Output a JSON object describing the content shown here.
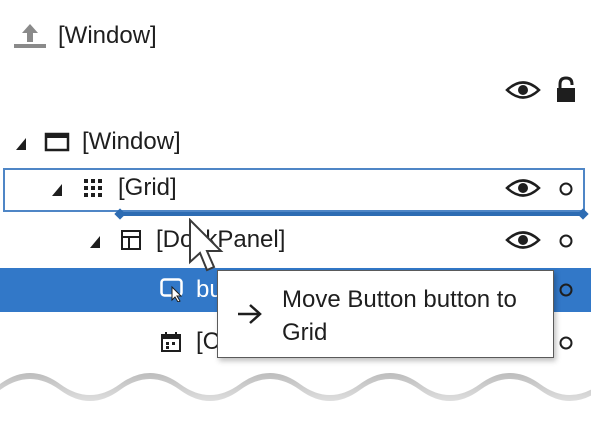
{
  "move_up": {
    "icon": "move-up-icon",
    "label": "[Window]"
  },
  "header": {
    "visibility_icon": "eye-icon",
    "lock_icon": "lock-icon"
  },
  "tree": {
    "window": {
      "label": "[Window]",
      "icon": "window-icon"
    },
    "grid": {
      "label": "[Grid]",
      "icon": "grid-icon"
    },
    "dockpanel": {
      "label": "[DockPanel]",
      "icon": "dockpanel-icon"
    },
    "button": {
      "label": "bu",
      "icon": "button-icon"
    },
    "calendar": {
      "label": "[C",
      "icon": "calendar-icon"
    }
  },
  "tooltip": {
    "icon": "arrow-right-icon",
    "text": "Move Button button to Grid"
  },
  "colors": {
    "selection": "#3278c8",
    "drop_outline": "#4f86c6",
    "insert_line": "#2d6cb3",
    "text": "#1e1e1e"
  }
}
